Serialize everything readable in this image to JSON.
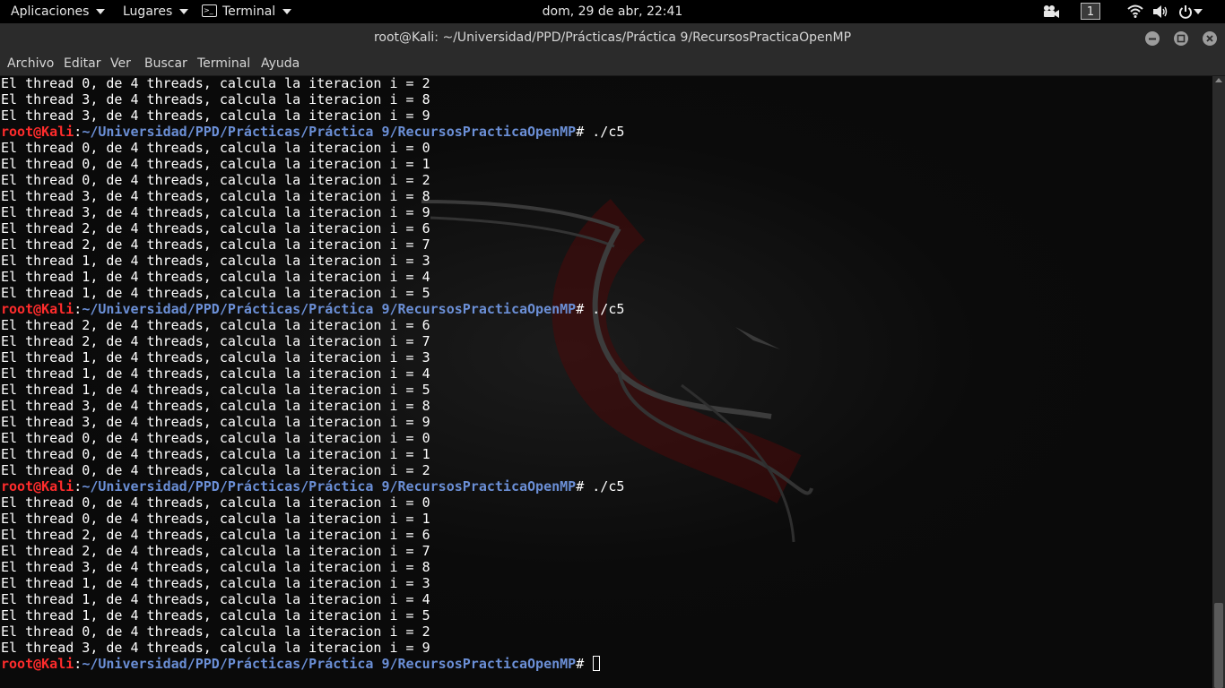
{
  "topbar": {
    "apps_label": "Aplicaciones",
    "places_label": "Lugares",
    "terminal_label": "Terminal",
    "clock": "dom, 29 de abr, 22:41",
    "workspace": "1"
  },
  "window": {
    "title": "root@Kali: ~/Universidad/PPD/Prácticas/Práctica 9/RecursosPracticaOpenMP"
  },
  "menubar": {
    "items": [
      "Archivo",
      "Editar",
      "Ver",
      "Buscar",
      "Terminal",
      "Ayuda"
    ]
  },
  "terminal": {
    "prompt_user": "root@Kali",
    "prompt_sep": ":",
    "prompt_path": "~/Universidad/PPD/Prácticas/Práctica 9/RecursosPracticaOpenMP",
    "prompt_end": "#",
    "lines": [
      {
        "type": "out",
        "text": "El thread 0, de 4 threads, calcula la iteracion i = 2"
      },
      {
        "type": "out",
        "text": "El thread 3, de 4 threads, calcula la iteracion i = 8"
      },
      {
        "type": "out",
        "text": "El thread 3, de 4 threads, calcula la iteracion i = 9"
      },
      {
        "type": "prompt",
        "cmd": " ./c5"
      },
      {
        "type": "out",
        "text": "El thread 0, de 4 threads, calcula la iteracion i = 0"
      },
      {
        "type": "out",
        "text": "El thread 0, de 4 threads, calcula la iteracion i = 1"
      },
      {
        "type": "out",
        "text": "El thread 0, de 4 threads, calcula la iteracion i = 2"
      },
      {
        "type": "out",
        "text": "El thread 3, de 4 threads, calcula la iteracion i = 8"
      },
      {
        "type": "out",
        "text": "El thread 3, de 4 threads, calcula la iteracion i = 9"
      },
      {
        "type": "out",
        "text": "El thread 2, de 4 threads, calcula la iteracion i = 6"
      },
      {
        "type": "out",
        "text": "El thread 2, de 4 threads, calcula la iteracion i = 7"
      },
      {
        "type": "out",
        "text": "El thread 1, de 4 threads, calcula la iteracion i = 3"
      },
      {
        "type": "out",
        "text": "El thread 1, de 4 threads, calcula la iteracion i = 4"
      },
      {
        "type": "out",
        "text": "El thread 1, de 4 threads, calcula la iteracion i = 5"
      },
      {
        "type": "prompt",
        "cmd": " ./c5"
      },
      {
        "type": "out",
        "text": "El thread 2, de 4 threads, calcula la iteracion i = 6"
      },
      {
        "type": "out",
        "text": "El thread 2, de 4 threads, calcula la iteracion i = 7"
      },
      {
        "type": "out",
        "text": "El thread 1, de 4 threads, calcula la iteracion i = 3"
      },
      {
        "type": "out",
        "text": "El thread 1, de 4 threads, calcula la iteracion i = 4"
      },
      {
        "type": "out",
        "text": "El thread 1, de 4 threads, calcula la iteracion i = 5"
      },
      {
        "type": "out",
        "text": "El thread 3, de 4 threads, calcula la iteracion i = 8"
      },
      {
        "type": "out",
        "text": "El thread 3, de 4 threads, calcula la iteracion i = 9"
      },
      {
        "type": "out",
        "text": "El thread 0, de 4 threads, calcula la iteracion i = 0"
      },
      {
        "type": "out",
        "text": "El thread 0, de 4 threads, calcula la iteracion i = 1"
      },
      {
        "type": "out",
        "text": "El thread 0, de 4 threads, calcula la iteracion i = 2"
      },
      {
        "type": "prompt",
        "cmd": " ./c5"
      },
      {
        "type": "out",
        "text": "El thread 0, de 4 threads, calcula la iteracion i = 0"
      },
      {
        "type": "out",
        "text": "El thread 0, de 4 threads, calcula la iteracion i = 1"
      },
      {
        "type": "out",
        "text": "El thread 2, de 4 threads, calcula la iteracion i = 6"
      },
      {
        "type": "out",
        "text": "El thread 2, de 4 threads, calcula la iteracion i = 7"
      },
      {
        "type": "out",
        "text": "El thread 3, de 4 threads, calcula la iteracion i = 8"
      },
      {
        "type": "out",
        "text": "El thread 1, de 4 threads, calcula la iteracion i = 3"
      },
      {
        "type": "out",
        "text": "El thread 1, de 4 threads, calcula la iteracion i = 4"
      },
      {
        "type": "out",
        "text": "El thread 1, de 4 threads, calcula la iteracion i = 5"
      },
      {
        "type": "out",
        "text": "El thread 0, de 4 threads, calcula la iteracion i = 2"
      },
      {
        "type": "out",
        "text": "El thread 3, de 4 threads, calcula la iteracion i = 9"
      },
      {
        "type": "prompt",
        "cmd": " ",
        "cursor": true
      }
    ]
  },
  "colors": {
    "prompt_user": "#ff2c2c",
    "prompt_path": "#6b8fd6",
    "text": "#ffffff",
    "chrome": "#2b2b2b"
  },
  "icons": {
    "camera": "camera-icon",
    "wifi": "wifi-icon",
    "volume": "volume-icon",
    "power": "power-icon",
    "minimize": "minimize-icon",
    "maximize": "maximize-icon",
    "close": "close-icon"
  }
}
